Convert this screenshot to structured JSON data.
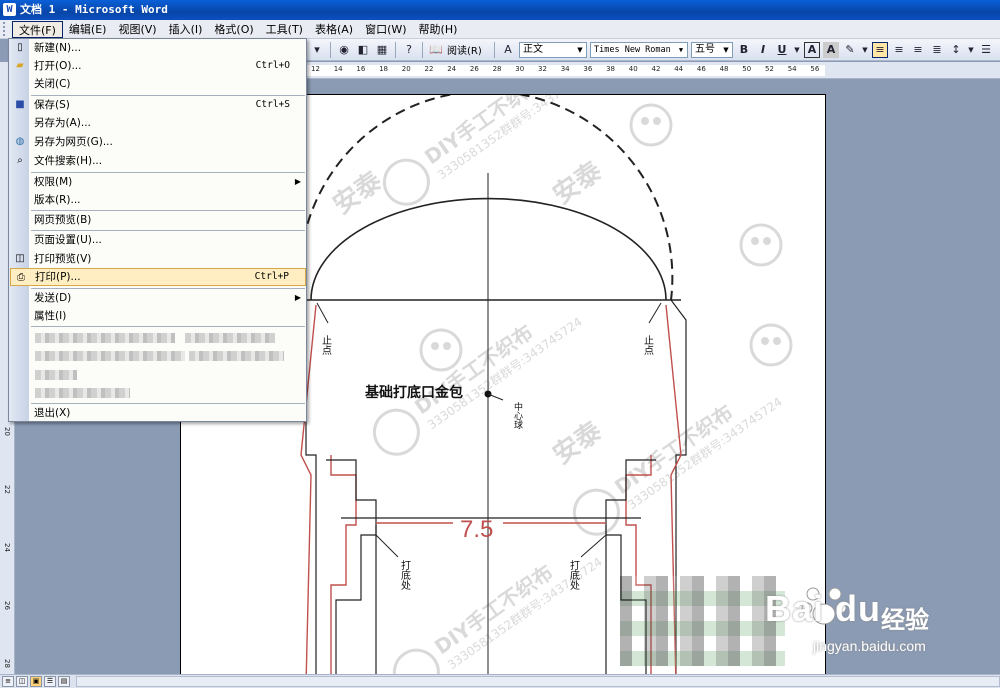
{
  "window": {
    "title": "文档 1 - Microsoft Word"
  },
  "menubar": {
    "items": [
      "文件(F)",
      "编辑(E)",
      "视图(V)",
      "插入(I)",
      "格式(O)",
      "工具(T)",
      "表格(A)",
      "窗口(W)",
      "帮助(H)"
    ],
    "active_index": 0
  },
  "toolbar": {
    "reading_label": "阅读(R)",
    "style_value": "正文",
    "font_value": "Times New Roman",
    "size_value": "五号",
    "bold": "B",
    "italic": "I",
    "underline": "U",
    "char_border": "A",
    "char_shade": "A"
  },
  "ruler": {
    "ticks": [
      "12",
      "14",
      "16",
      "18",
      "20",
      "22",
      "24",
      "26",
      "28",
      "30",
      "32",
      "34",
      "36",
      "38",
      "40",
      "42",
      "44",
      "46",
      "48",
      "50",
      "52",
      "54",
      "56"
    ]
  },
  "vruler": {
    "ticks": [
      "20",
      "22",
      "24",
      "26",
      "28"
    ]
  },
  "file_menu": {
    "items": [
      {
        "label": "新建(N)...",
        "shortcut": "",
        "icon": "new-doc-icon"
      },
      {
        "label": "打开(O)...",
        "shortcut": "Ctrl+O",
        "icon": "open-folder-icon"
      },
      {
        "label": "关闭(C)",
        "shortcut": "",
        "icon": ""
      },
      {
        "label": "保存(S)",
        "shortcut": "Ctrl+S",
        "icon": "save-disk-icon"
      },
      {
        "label": "另存为(A)...",
        "shortcut": "",
        "icon": ""
      },
      {
        "label": "另存为网页(G)...",
        "shortcut": "",
        "icon": "save-web-icon"
      },
      {
        "label": "文件搜索(H)...",
        "shortcut": "",
        "icon": "search-file-icon"
      },
      {
        "label": "权限(M)",
        "shortcut": "",
        "icon": ""
      },
      {
        "label": "版本(R)...",
        "shortcut": "",
        "icon": ""
      },
      {
        "label": "网页预览(B)",
        "shortcut": "",
        "icon": ""
      },
      {
        "label": "页面设置(U)...",
        "shortcut": "",
        "icon": ""
      },
      {
        "label": "打印预览(V)",
        "shortcut": "",
        "icon": "print-preview-icon"
      },
      {
        "label": "打印(P)...",
        "shortcut": "Ctrl+P",
        "icon": "printer-icon"
      },
      {
        "label": "发送(D)",
        "shortcut": "",
        "icon": ""
      },
      {
        "label": "属性(I)",
        "shortcut": "",
        "icon": ""
      },
      {
        "label": "退出(X)",
        "shortcut": "",
        "icon": ""
      }
    ],
    "highlighted_label": "打印(P)..."
  },
  "document": {
    "label_stop_left": "止点",
    "label_stop_right": "止点",
    "label_center": "中心球",
    "label_title": "基础打底口金包",
    "label_base_left": "打底处",
    "label_base_right": "打底处",
    "dimension": "7.5",
    "watermark_brand": "DIY手工不织布",
    "watermark_qq": "3330581352群群号:343745724",
    "watermark_name": "安泰"
  },
  "baidu": {
    "word": "Bai du",
    "cn": "经验",
    "url": "jingyan.baidu.com"
  },
  "colors": {
    "titlebar": "#0a5fd8",
    "menu_highlight": "#ffeec2",
    "pattern_red": "#c0504d"
  }
}
